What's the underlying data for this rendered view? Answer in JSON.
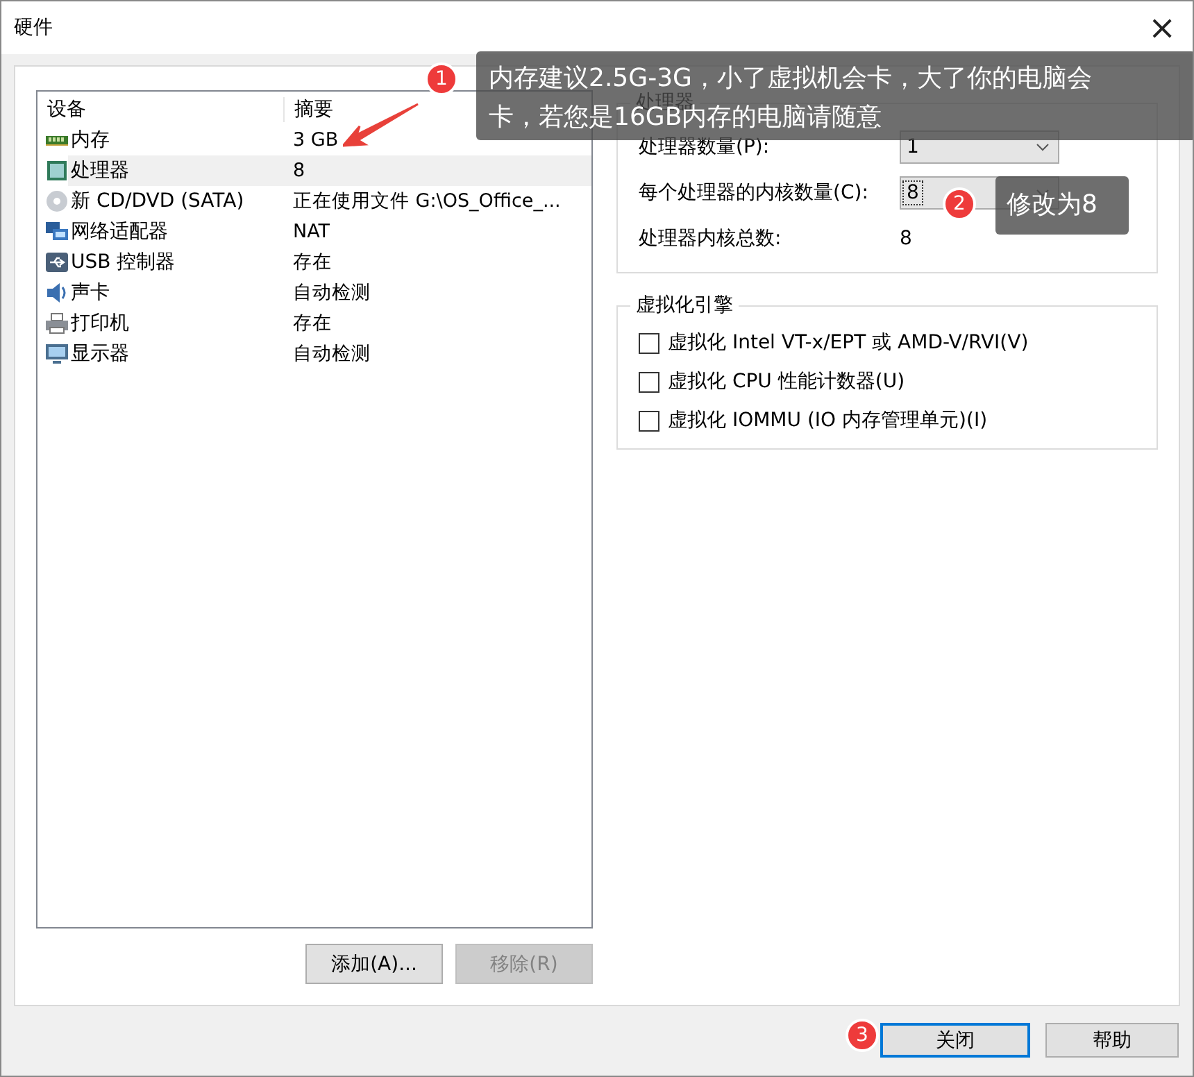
{
  "window": {
    "title": "硬件",
    "close_glyph": "×"
  },
  "device_list": {
    "columns": [
      "设备",
      "摘要"
    ],
    "rows": [
      {
        "kind": "memory",
        "device": "内存",
        "summary": "3 GB",
        "selected": false
      },
      {
        "kind": "cpu",
        "device": "处理器",
        "summary": "8",
        "selected": true
      },
      {
        "kind": "cd",
        "device": "新 CD/DVD (SATA)",
        "summary": "正在使用文件 G:\\OS_Office_...",
        "selected": false
      },
      {
        "kind": "network",
        "device": "网络适配器",
        "summary": "NAT",
        "selected": false
      },
      {
        "kind": "usb",
        "device": "USB 控制器",
        "summary": "存在",
        "selected": false
      },
      {
        "kind": "sound",
        "device": "声卡",
        "summary": "自动检测",
        "selected": false
      },
      {
        "kind": "printer",
        "device": "打印机",
        "summary": "存在",
        "selected": false
      },
      {
        "kind": "display",
        "device": "显示器",
        "summary": "自动检测",
        "selected": false
      }
    ]
  },
  "list_buttons": [
    {
      "label": "添加(A)...",
      "disabled": false
    },
    {
      "label": "移除(R)",
      "disabled": true
    }
  ],
  "processors": {
    "title": "处理器",
    "fields": [
      {
        "kind": "combo",
        "label": "处理器数量(P):",
        "value": "1"
      },
      {
        "kind": "combo",
        "label": "每个处理器的内核数量(C):",
        "value": "8"
      },
      {
        "kind": "text",
        "label": "处理器内核总数:",
        "value": "8"
      }
    ]
  },
  "virtualization": {
    "title": "虚拟化引擎",
    "options": [
      {
        "label": "虚拟化 Intel VT-x/EPT 或 AMD-V/RVI(V)",
        "checked": false
      },
      {
        "label": "虚拟化 CPU 性能计数器(U)",
        "checked": false
      },
      {
        "label": "虚拟化 IOMMU (IO 内存管理单元)(I)",
        "checked": false
      }
    ]
  },
  "footer_buttons": [
    {
      "label": "关闭",
      "default": true
    },
    {
      "label": "帮助",
      "default": false
    }
  ],
  "annotations": [
    {
      "number": "1",
      "text": "内存建议2.5G-3G，小了虚拟机会卡，大了你的电脑会卡，若您是16GB内存的电脑请随意"
    },
    {
      "number": "2",
      "text": "修改为8"
    },
    {
      "number": "3"
    }
  ]
}
